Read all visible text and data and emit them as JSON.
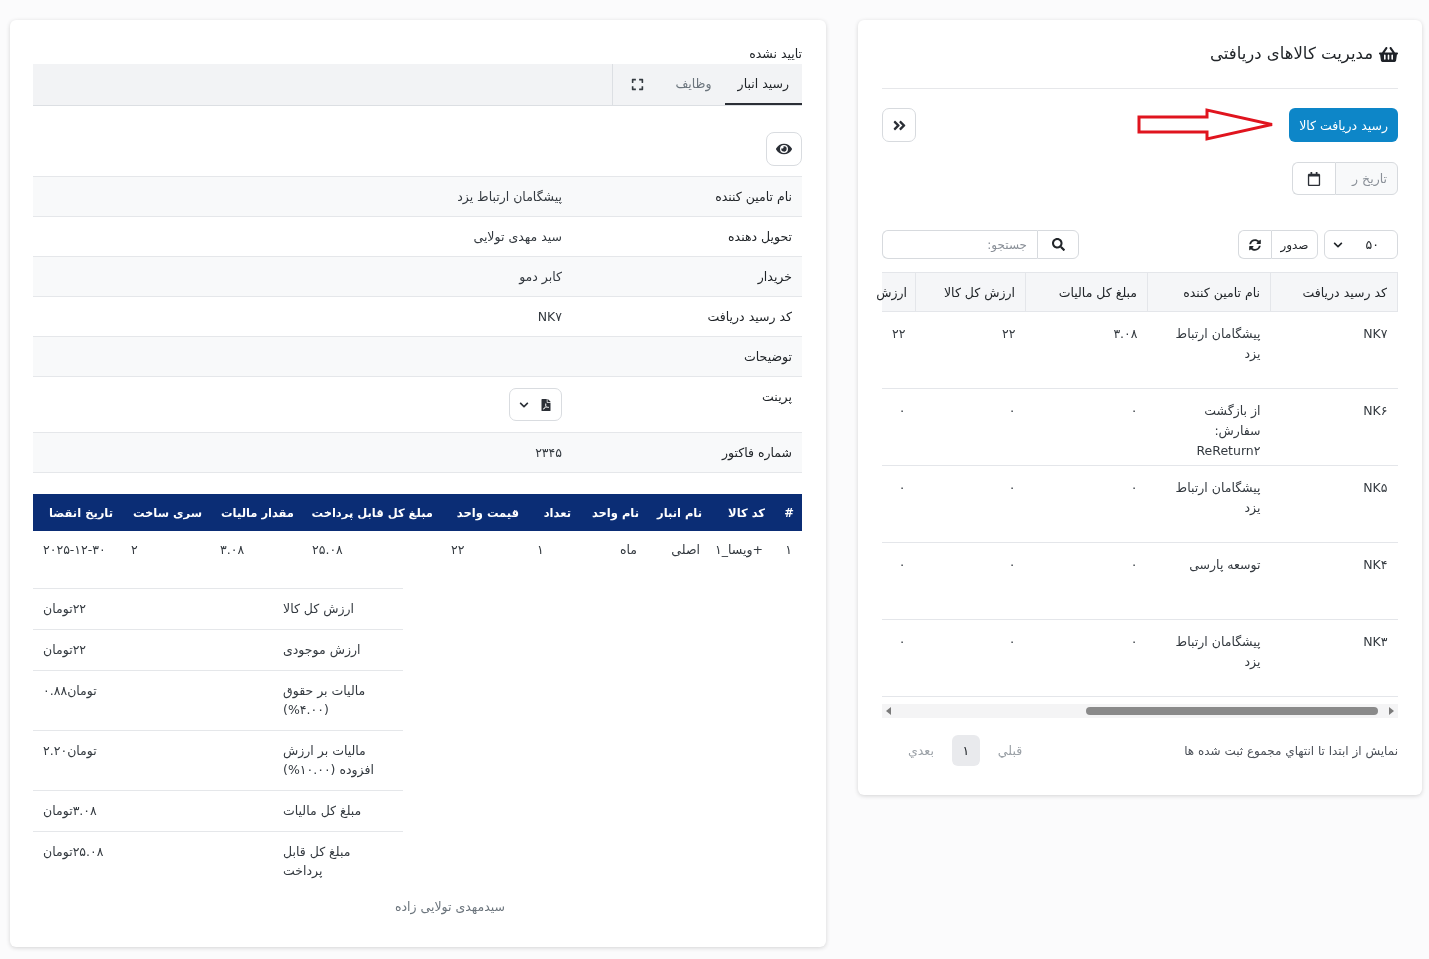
{
  "receipts_panel": {
    "title": "مدیریت کالاهای دریافتی",
    "new_receipt_button": "رسید دریافت کالا",
    "date_filter": {
      "placeholder": "تاریخ ر"
    },
    "page_size": "۵۰",
    "export_button": "صدور",
    "search": {
      "placeholder": "جستجو:"
    },
    "table": {
      "columns": [
        "کد رسید دریافت",
        "نام تامین کننده",
        "مبلغ کل مالیات",
        "ارزش کل کالا",
        "ارزش"
      ],
      "rows": [
        [
          "NK۷",
          "پیشگامان ارتباط یزد",
          "۳.۰۸",
          "۲۲",
          "۲۲"
        ],
        [
          "NK۶",
          "از بازگشت سفارش: ReReturn۲",
          "۰",
          "۰",
          "۰"
        ],
        [
          "NK۵",
          "پیشگامان ارتباط یزد",
          "۰",
          "۰",
          "۰"
        ],
        [
          "NK۴",
          "توسعه پارسی",
          "۰",
          "۰",
          "۰"
        ],
        [
          "NK۳",
          "پیشگامان ارتباط یزد",
          "۰",
          "۰",
          "۰"
        ]
      ]
    },
    "footer_text": "نمایش از ابتدا تا انتهاي مجموع ثبت شده ها",
    "pagination": {
      "previous": {
        "label": "قبلي",
        "disabled": true
      },
      "pages": [
        {
          "label": "۱",
          "selected": true
        }
      ],
      "next": {
        "label": "بعدي",
        "disabled": true
      }
    }
  },
  "receipt_detail": {
    "status": "تایید نشده",
    "tabs": [
      {
        "label": "رسید انبار",
        "selected": true
      },
      {
        "label": "وظایف",
        "selected": false
      }
    ],
    "fields": [
      {
        "kind": "text",
        "label": "نام تامین کننده",
        "value": "پیشگامان ارتباط یزد"
      },
      {
        "kind": "text",
        "label": "تحویل دهنده",
        "value": "سید مهدی تولایی"
      },
      {
        "kind": "text",
        "label": "خریدار",
        "value": "کابر دمو"
      },
      {
        "kind": "text",
        "label": "کد رسید دریافت",
        "value": "NK۷"
      },
      {
        "kind": "text",
        "label": "توضیحات"
      },
      {
        "kind": "print",
        "label": "پرینت"
      },
      {
        "kind": "text",
        "label": "شماره فاکتور",
        "value": "۲۳۴۵"
      }
    ],
    "items_table": {
      "columns": [
        {
          "label": "#",
          "kind": "text"
        },
        {
          "label": "کد کالا",
          "kind": "text"
        },
        {
          "label": "نام انبار",
          "kind": "text"
        },
        {
          "label": "نام واحد",
          "kind": "text"
        },
        {
          "label": "تعداد",
          "kind": "number"
        },
        {
          "label": "قیمت واحد",
          "kind": "number"
        },
        {
          "label": "مبلغ کل قابل پرداخت",
          "kind": "number"
        },
        {
          "label": "مقدار مالیات",
          "kind": "number"
        },
        {
          "label": "سری ساخت",
          "kind": "number"
        },
        {
          "label": "تاریخ انقضا",
          "kind": "number"
        }
      ],
      "rows": [
        [
          "۱",
          "+ویسا_۱",
          "اصلی",
          "ماه",
          "۱",
          "۲۲",
          "۲۵.۰۸",
          "۳.۰۸",
          "۲",
          "۲۰۲۵-۱۲-۳۰"
        ]
      ]
    },
    "totals": [
      {
        "label": "ارزش کل کالا",
        "value": "۲۲تومان"
      },
      {
        "label": "ارزش موجودی",
        "value": "۲۲تومان"
      },
      {
        "label": "مالیات بر حقوق (۴.۰۰%)",
        "value": "تومان۰.۸۸"
      },
      {
        "label": "مالیات بر ارزش افزوده (۱۰.۰۰%)",
        "value": "تومان۲.۲۰"
      },
      {
        "label": "مبلغ کل مالیات",
        "value": "۳.۰۸تومان"
      },
      {
        "label": "مبلغ کل قابل پرداخت",
        "value": "۲۵.۰۸تومان"
      }
    ],
    "signature": "سیدمهدی تولایی زاده"
  }
}
